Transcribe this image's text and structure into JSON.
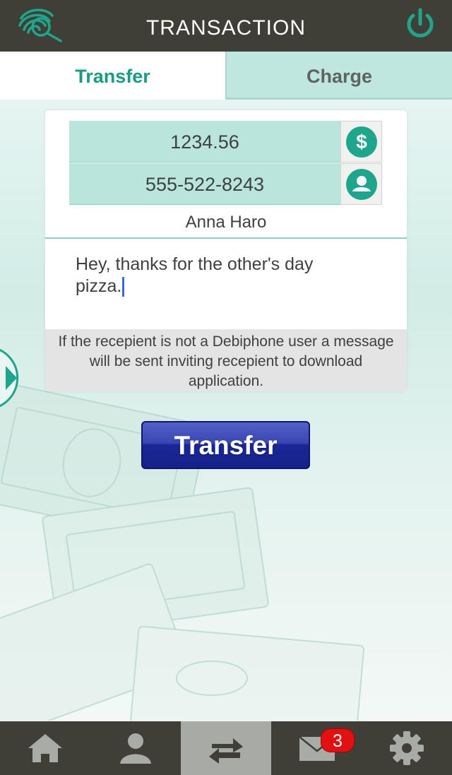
{
  "header": {
    "title": "TRANSACTION",
    "logo_icon": "fingerprint-magnifier-logo",
    "power_icon": "power-icon",
    "accent_color": "#1a9b86"
  },
  "tabs": [
    {
      "label": "Transfer",
      "active": true
    },
    {
      "label": "Charge",
      "active": false
    }
  ],
  "form": {
    "amount": "1234.56",
    "amount_icon": "dollar-icon",
    "phone": "555-522-8243",
    "contact_icon": "contact-icon",
    "recipient_name": "Anna Haro",
    "message_line1": "Hey, thanks for the other's day",
    "message_line2": "pizza.",
    "notice": "If the recepient is not a Debiphone user a message will be sent inviting recepient to download application."
  },
  "side_handle_icon": "chevron-right-icon",
  "transfer_button_label": "Transfer",
  "bottom_nav": {
    "items": [
      {
        "name": "home",
        "icon": "home-icon",
        "active": false
      },
      {
        "name": "contacts",
        "icon": "user-icon",
        "active": false
      },
      {
        "name": "transaction",
        "icon": "transfer-arrows-icon",
        "active": true
      },
      {
        "name": "messages",
        "icon": "mail-icon",
        "active": false
      },
      {
        "name": "settings",
        "icon": "gear-icon",
        "active": false
      }
    ],
    "messages_badge": "3"
  }
}
